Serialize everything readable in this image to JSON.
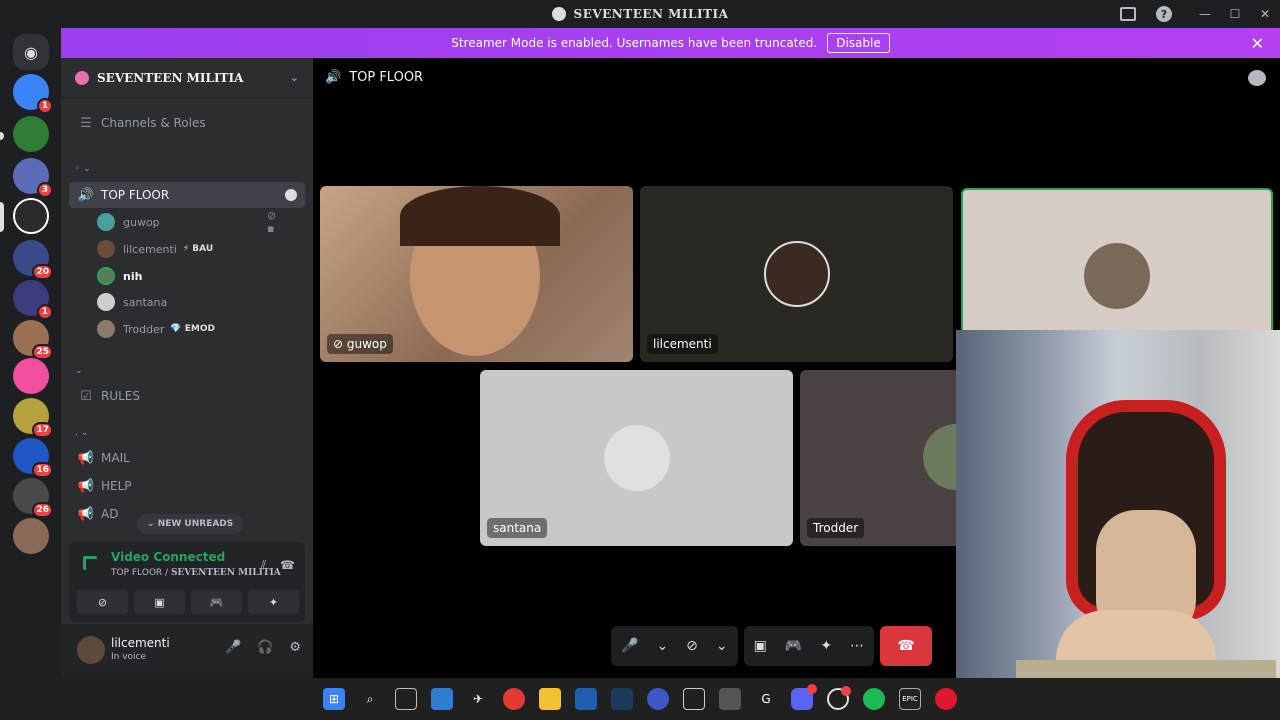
{
  "window": {
    "title": "SEVENTEEN MILITIA"
  },
  "banner": {
    "text": "Streamer Mode is enabled. Usernames have been truncated.",
    "disable_label": "Disable",
    "close_icon": "close-icon"
  },
  "server_rail": {
    "home_icon": "discord-icon",
    "servers": [
      {
        "name": "server-1",
        "badge": "1",
        "color": "#3b82f6"
      },
      {
        "name": "server-2",
        "badge": "",
        "color": "#2e7d32"
      },
      {
        "name": "server-3",
        "badge": "3",
        "color": "#5b6bb5"
      },
      {
        "name": "server-4",
        "badge": "",
        "color": "#2a2a2a"
      },
      {
        "name": "server-5",
        "badge": "20",
        "color": "#384a8a"
      },
      {
        "name": "server-6",
        "badge": "1",
        "color": "#3c3c7c"
      },
      {
        "name": "server-7",
        "badge": "25",
        "color": "#9a7052"
      },
      {
        "name": "server-8",
        "badge": "",
        "color": "#f24fa0"
      },
      {
        "name": "server-9",
        "badge": "17",
        "color": "#b6a23c"
      },
      {
        "name": "server-10",
        "badge": "16",
        "color": "#1f57c4"
      },
      {
        "name": "server-11",
        "badge": "26",
        "color": "#4a4a4a"
      },
      {
        "name": "server-12",
        "badge": "",
        "color": "#8a6a55"
      }
    ]
  },
  "sidebar": {
    "server_name": "SEVENTEEN MILITIA",
    "channels_roles": "Channels & Roles",
    "category_1": "◦ ⌄",
    "active_channel": "TOP FLOOR",
    "voice_users": [
      {
        "name": "guwop",
        "tag": "",
        "color": "#4a9e9e"
      },
      {
        "name": "lilcementi",
        "tag": "⚡ BAU",
        "color": "#6a4a3a"
      },
      {
        "name": "nih",
        "tag": "",
        "color": "#5a7a5a"
      },
      {
        "name": "santana",
        "tag": "",
        "color": "#cfcfcf"
      },
      {
        "name": "Trodder",
        "tag": "💎 EMOD",
        "color": "#8a7a6a"
      }
    ],
    "category_2": "⌄",
    "rules_channel": "RULES",
    "category_3": ". ⌄",
    "channels": [
      "MAIL",
      "HELP",
      "AD"
    ],
    "new_unreads": "NEW UNREADS"
  },
  "voice_panel": {
    "status": "Video Connected",
    "channel": "TOP FLOOR",
    "server": "SEVENTEEN MILITIA"
  },
  "user_panel": {
    "username": "lilcementi",
    "status": "In voice"
  },
  "stage": {
    "channel_title": "TOP FLOOR",
    "tiles": [
      {
        "name": "guwop"
      },
      {
        "name": "lilcementi"
      },
      {
        "name": ""
      },
      {
        "name": "santana"
      },
      {
        "name": "Trodder"
      }
    ]
  },
  "taskbar": {
    "apps": [
      "windows-icon",
      "search-icon",
      "task-view-icon",
      "photos-icon",
      "app-icon",
      "chrome-icon",
      "file-explorer-icon",
      "app-icon-2",
      "steam-icon",
      "app-icon-3",
      "snipping-icon",
      "camera-icon",
      "app-icon-4",
      "discord-icon",
      "app-icon-5",
      "spotify-icon",
      "epic-icon",
      "opera-icon"
    ]
  }
}
